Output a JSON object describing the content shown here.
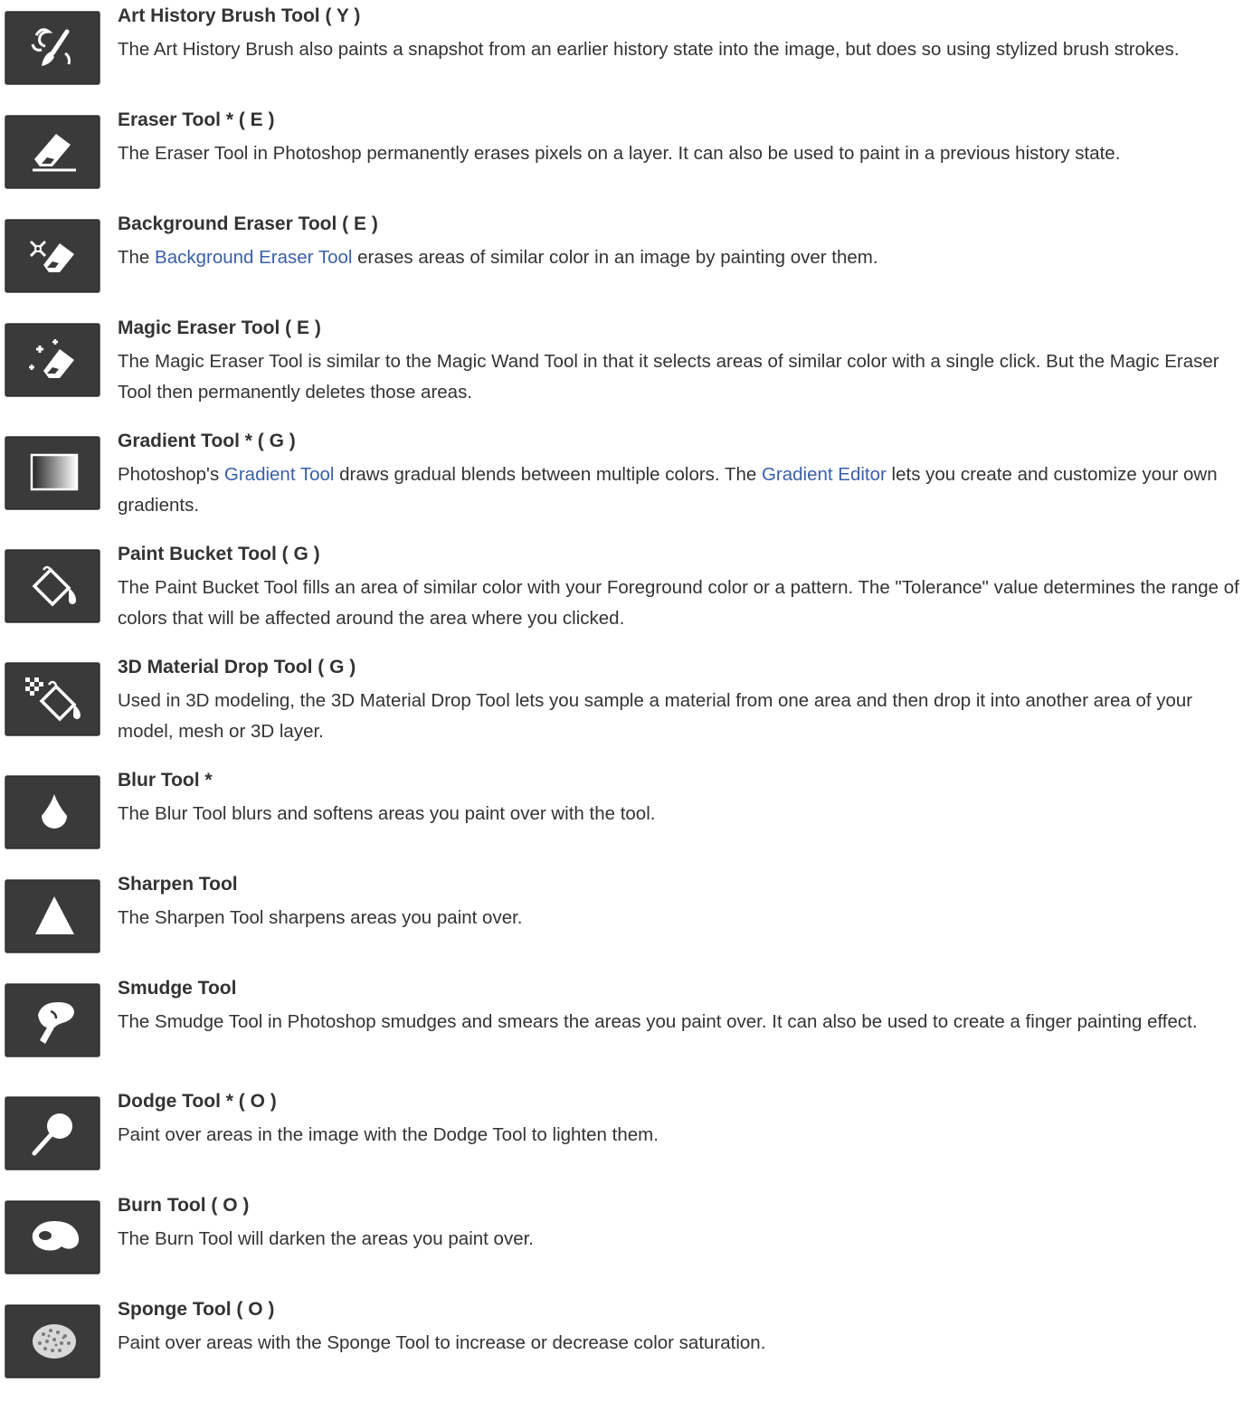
{
  "tools": [
    {
      "title": "Art History Brush Tool ( Y )",
      "icon": "art-history-brush-icon",
      "desc": [
        "The Art History Brush also paints a snapshot from an earlier history state into the image, but does so using stylized brush strokes."
      ]
    },
    {
      "title": "Eraser Tool * ( E )",
      "icon": "eraser-icon",
      "desc": [
        "The Eraser Tool in Photoshop permanently erases pixels on a layer. It can also be used to paint in a previous history state."
      ]
    },
    {
      "title": "Background Eraser Tool ( E )",
      "icon": "background-eraser-icon",
      "desc": [
        "The ",
        "Background Eraser Tool",
        " erases areas of similar color in an image by painting over them."
      ]
    },
    {
      "title": "Magic Eraser Tool ( E )",
      "icon": "magic-eraser-icon",
      "desc": [
        "The Magic Eraser Tool is similar to the Magic Wand Tool in that it selects areas of similar color with a single click. But the Magic Eraser Tool then permanently deletes those areas."
      ]
    },
    {
      "title": "Gradient Tool * ( G )",
      "icon": "gradient-icon",
      "desc": [
        "Photoshop's ",
        "Gradient Tool",
        " draws gradual blends between multiple colors. The ",
        "Gradient Editor",
        " lets you create and customize your own gradients."
      ]
    },
    {
      "title": "Paint Bucket Tool ( G )",
      "icon": "paint-bucket-icon",
      "desc": [
        "The Paint Bucket Tool fills an area of similar color with your Foreground color or a pattern. The \"Tolerance\" value determines the range of colors that will be affected around the area where you clicked."
      ]
    },
    {
      "title": "3D Material Drop Tool ( G )",
      "icon": "material-drop-icon",
      "desc": [
        "Used in 3D modeling, the 3D Material Drop Tool lets you sample a material from one area and then drop it into another area of your model, mesh or 3D layer."
      ]
    },
    {
      "title": "Blur Tool *",
      "icon": "blur-drop-icon",
      "desc": [
        "The Blur Tool blurs and softens areas you paint over with the tool."
      ]
    },
    {
      "title": "Sharpen Tool",
      "icon": "sharpen-triangle-icon",
      "desc": [
        "The Sharpen Tool sharpens areas you paint over."
      ]
    },
    {
      "title": "Smudge Tool",
      "icon": "smudge-finger-icon",
      "desc": [
        "The Smudge Tool in Photoshop smudges and smears the areas you paint over. It can also be used to create a finger painting effect."
      ]
    },
    {
      "title": "Dodge Tool * ( O )",
      "icon": "dodge-icon",
      "desc": [
        "Paint over areas in the image with the Dodge Tool to lighten them."
      ]
    },
    {
      "title": "Burn Tool ( O )",
      "icon": "burn-hand-icon",
      "desc": [
        "The Burn Tool will darken the areas you paint over."
      ]
    },
    {
      "title": "Sponge Tool ( O )",
      "icon": "sponge-icon",
      "desc": [
        "Paint over areas with the Sponge Tool to increase or decrease color saturation."
      ]
    }
  ],
  "colors": {
    "link": "#3a5fa8",
    "text": "#333333",
    "icon_bg": "#3a3a3a",
    "icon_fg": "#ffffff"
  }
}
